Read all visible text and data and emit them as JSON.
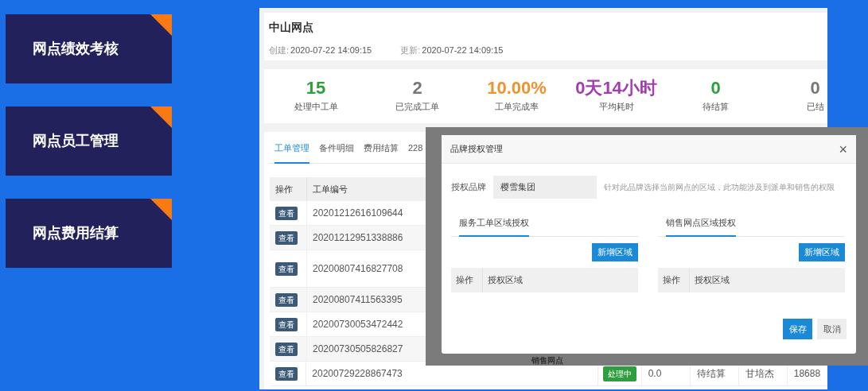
{
  "menu_cards": [
    {
      "label": "网点绩效考核"
    },
    {
      "label": "网点员工管理"
    },
    {
      "label": "网点费用结算"
    }
  ],
  "station": {
    "title": "中山网点",
    "created_label": "创建:",
    "created": "2020-07-22 14:09:15",
    "updated_label": "更新:",
    "updated": "2020-07-22 14:09:15"
  },
  "stats": [
    {
      "value": "15",
      "label": "处理中工单",
      "color": "#2e9e3e"
    },
    {
      "value": "2",
      "label": "已完成工单",
      "color": "#777777"
    },
    {
      "value": "10.00%",
      "label": "工单完成率",
      "color": "#f0922e"
    },
    {
      "value": "0天14小时",
      "label": "平均耗时",
      "color": "#a23cb0"
    },
    {
      "value": "0",
      "label": "待结算",
      "color": "#2e9e3e"
    },
    {
      "value": "0",
      "label": "已结",
      "color": "#777777"
    }
  ],
  "tabs": [
    {
      "label": "工单管理",
      "selected": true
    },
    {
      "label": "备件明细",
      "selected": false
    },
    {
      "label": "费用结算",
      "selected": false
    },
    {
      "label": "228",
      "selected": false
    }
  ],
  "table": {
    "columns": [
      "操作",
      "工单编号"
    ],
    "rows": [
      {
        "action": "查看",
        "number": "20201212616109644"
      },
      {
        "action": "查看",
        "number": "20201212951338886"
      },
      {
        "action": "查看",
        "number": "20200807416827708"
      },
      {
        "action": "查看",
        "number": "20200807411563395"
      },
      {
        "action": "查看",
        "number": "20200730053472442"
      },
      {
        "action": "查看",
        "number": "20200730505826827"
      },
      {
        "action": "查看",
        "number": "20200729228867473",
        "status": "处理中",
        "cells": [
          "0.0",
          "待结算",
          "甘培杰",
          "18688"
        ]
      }
    ]
  },
  "background_header": "销售网点",
  "dialog": {
    "title": "品牌授权管理",
    "close": "×",
    "brand_label": "授权品牌",
    "brand_value": "樱雪集团",
    "hint": "针对此品牌选择当前网点的区域，此功能涉及到派单和销售的权限",
    "sections": [
      {
        "tab": "服务工单区域授权",
        "add_button": "新增区域",
        "columns": [
          "操作",
          "授权区域"
        ]
      },
      {
        "tab": "销售网点区域授权",
        "add_button": "新增区域",
        "columns": [
          "操作",
          "授权区域"
        ]
      }
    ],
    "buttons": [
      {
        "label": "保存",
        "kind": "primary"
      },
      {
        "label": "取消",
        "kind": "secondary"
      }
    ]
  }
}
